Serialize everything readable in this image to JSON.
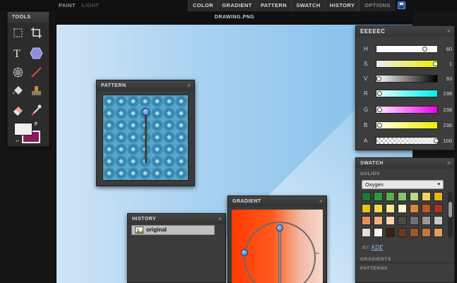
{
  "menubar": {
    "left": [
      "PAINT",
      "LIGHT"
    ],
    "tabs": [
      "COLOR",
      "GRADIENT",
      "PATTERN",
      "SWATCH",
      "HISTORY",
      "OPTIONS"
    ]
  },
  "document": {
    "title": "DRAWING.PNG"
  },
  "tools": {
    "title": "TOOLS",
    "items": [
      "marquee-select",
      "crop",
      "text",
      "shape",
      "spirograph",
      "line",
      "paint-bucket",
      "stamp",
      "eraser",
      "eyedropper"
    ],
    "foreground_label": "F",
    "foreground_color": "#eeeeec",
    "background_color": "#8b1a5e"
  },
  "pattern": {
    "title": "PATTERN"
  },
  "history": {
    "title": "HISTORY",
    "items": [
      "original"
    ]
  },
  "gradient": {
    "title": "GRADIENT"
  },
  "color": {
    "title": "EEEEEC",
    "rows": [
      {
        "label": "H",
        "value": "60"
      },
      {
        "label": "S",
        "value": "1"
      },
      {
        "label": "V",
        "value": "93"
      },
      {
        "label": "R",
        "value": "238"
      },
      {
        "label": "G",
        "value": "238"
      },
      {
        "label": "B",
        "value": "236"
      },
      {
        "label": "A",
        "value": "100"
      }
    ]
  },
  "swatch": {
    "title": "SWATCH",
    "solids_label": "SOLIDS",
    "selected_set": "Oxygen",
    "by_label": "BY:",
    "author": "KDE",
    "gradients_label": "GRADIENTS",
    "patterns_label": "PATTERNS",
    "colors": [
      "#1c7a3a",
      "#2a9a3e",
      "#5bb04c",
      "#8bc46a",
      "#b8d98a",
      "#f2d25c",
      "#e8b21c",
      "#e8c41a",
      "#f0d84a",
      "#f6e88a",
      "#fbf2c8",
      "#d68a3a",
      "#c0562a",
      "#a8341e",
      "#e69060",
      "#f0b07c",
      "#f8d4b0",
      "#4a4a48",
      "#707070",
      "#9a9a98",
      "#c8c8c6",
      "#dededc",
      "#f4f4f2",
      "#3a2010",
      "#6a3a18",
      "#9a5a2a",
      "#c07a3a",
      "#e0a060"
    ]
  }
}
